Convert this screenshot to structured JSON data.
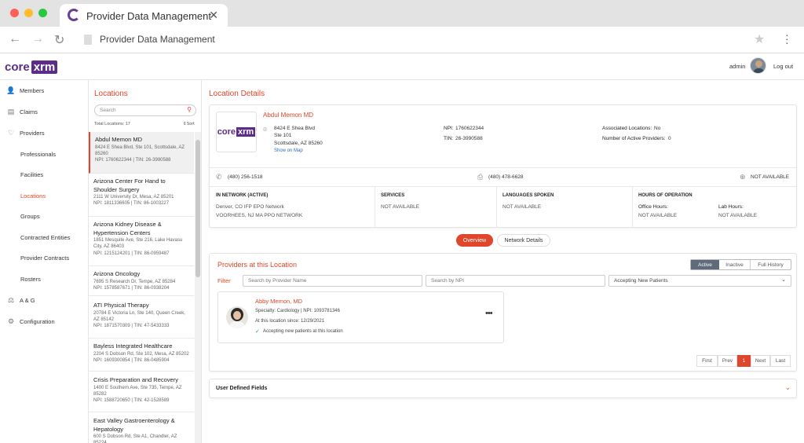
{
  "browser": {
    "tab_title": "Provider Data Management",
    "url": "Provider Data Management"
  },
  "header": {
    "logo_core": "core",
    "logo_xrm": "xrm",
    "user": "admin",
    "logout": "Log out"
  },
  "sidebar": {
    "items": [
      {
        "label": "Members",
        "icon": "members-icon"
      },
      {
        "label": "Claims",
        "icon": "claims-icon"
      },
      {
        "label": "Providers",
        "icon": "providers-icon"
      },
      {
        "label": "Professionals"
      },
      {
        "label": "Facilities"
      },
      {
        "label": "Locations"
      },
      {
        "label": "Groups"
      },
      {
        "label": "Contracted Entities"
      },
      {
        "label": "Provider Contracts"
      },
      {
        "label": "Rosters"
      },
      {
        "label": "A & G",
        "icon": "ag-icon"
      },
      {
        "label": "Configuration",
        "icon": "gear-icon"
      }
    ]
  },
  "locations": {
    "title": "Locations",
    "search_placeholder": "Search",
    "total": "Total Locations: 17",
    "sort": "Sort",
    "items": [
      {
        "name": "Abdul Memon MD",
        "addr": "8424 E Shea Blvd, Ste 101, Scottsdale, AZ 85260",
        "ids": "NPI: 1760622344 | TIN: 26-3990588"
      },
      {
        "name": "Arizona Center For Hand to Shoulder Surgery",
        "addr": "2111 W University Dr, Mesa, AZ 85201",
        "ids": "NPI: 1811336605 | TIN: 86-1003227"
      },
      {
        "name": "Arizona Kidney Disease & Hypertension Centers",
        "addr": "1851 Mesquite Ave, Ste 216, Lake Havasu City, AZ 86403",
        "ids": "NPI: 1215124201 | TIN: 86-0959487"
      },
      {
        "name": "Arizona Oncology",
        "addr": "7695 S Research Dr, Tempe, AZ 85284",
        "ids": "NPI: 1578587671 | TIN: 86-0938204"
      },
      {
        "name": "ATI Physical Therapy",
        "addr": "20784 E Victoria Ln, Ste 140, Queen Creek, AZ 85142",
        "ids": "NPI: 1871570309 | TIN: 47-5433333"
      },
      {
        "name": "Bayless Integrated Healthcare",
        "addr": "2204 S Dobson Rd, Ste 102, Mesa, AZ 85202",
        "ids": "NPI: 1609300854 | TIN: 86-0485904"
      },
      {
        "name": "Crisis Preparation and Recovery",
        "addr": "1400 E Southern Ave, Ste 735, Tempe, AZ 85282",
        "ids": "NPI: 1588720650 | TIN: 42-1528589"
      },
      {
        "name": "East Valley Gastroenterology & Hepatology",
        "addr": "600 S Dobson Rd, Ste A1, Chandler, AZ 85224",
        "ids": ""
      }
    ]
  },
  "details": {
    "title": "Location Details",
    "name": "Abdul Memon MD",
    "addr1": "8424 E Shea Blvd",
    "addr2": "Ste 101",
    "addr3": "Scottsdale,  AZ 85260",
    "map_link": "Show on Map",
    "npi_label": "NPI:",
    "npi": "1760622344",
    "tin_label": "TIN:",
    "tin": "26-3990588",
    "assoc_label": "Associated Locations:",
    "assoc": "No",
    "active_prov_label": "Number of Active Providers:",
    "active_prov": "0",
    "phone": "(480) 256-1518",
    "fax": "(480) 478-6628",
    "web": "NOT AVAILABLE",
    "in_network_hdr": "IN NETWORK (ACTIVE)",
    "networks": [
      "Denver, CO IFP EPO Network",
      "VOORHEES, NJ MA PPO NETWORK"
    ],
    "services_hdr": "SERVICES",
    "services": "NOT AVAILABLE",
    "languages_hdr": "LANGUAGES SPOKEN",
    "languages": "NOT AVAILABLE",
    "hours_hdr": "HOURS OF OPERATION",
    "office_hours_label": "Office Hours:",
    "office_hours": "NOT AVAILABLE",
    "lab_hours_label": "Lab Hours:",
    "lab_hours": "NOT AVAILABLE"
  },
  "tabs": {
    "overview": "Overview",
    "network": "Network Details"
  },
  "providers": {
    "title": "Providers at this Location",
    "toggle": [
      "Active",
      "Inactive",
      "Full History"
    ],
    "filter_label": "Filter",
    "search_name": "Search by Provider Name",
    "search_npi": "Search by NPI",
    "accepting_select": "Accepting New Patients",
    "card": {
      "name": "Abby Memon, MD",
      "spec": "Specialty: Cardiology | NPI: 1093781346",
      "since": "At this location since: 12/29/2021",
      "accepting": "Accepting new patients at this location"
    },
    "pagination": [
      "First",
      "Prev",
      "1",
      "Next",
      "Last"
    ]
  },
  "udf": {
    "title": "User Defined Fields"
  },
  "colors": {
    "accent": "#e0462b",
    "brand": "#5b2d86"
  }
}
